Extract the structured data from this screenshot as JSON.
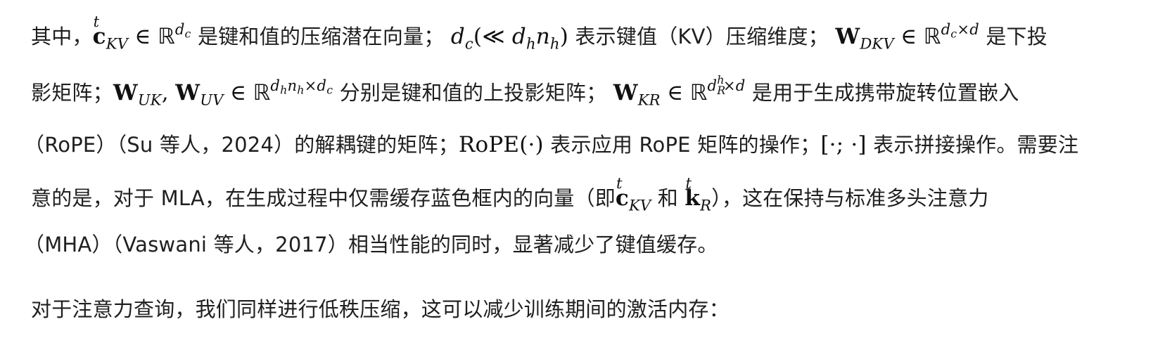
{
  "paragraph1": {
    "l1_a": "其中，",
    "l1_b": "是键和值的压缩潜在向量；",
    "l1_c": "表示键值（KV）压缩维度；",
    "l1_d": "是下投",
    "l2_a": "影矩阵；",
    "l2_b": "分别是键和值的上投影矩阵；",
    "l2_c": "是用于生成携带旋转位置嵌入",
    "l3_a": "（RoPE）（Su 等人，2024）的解耦键的矩阵；",
    "l3_b": "表示应用 RoPE 矩阵的操作；",
    "l3_c": "表示拼接操作。需要注",
    "l4_a": "意的是，对于 MLA，在生成过程中仅需缓存蓝色框内的向量（即",
    "l4_b": "和",
    "l4_c": "），这在保持与标准多头注意力",
    "l5_a": "（MHA）（Vaswani 等人，2017）相当性能的同时，显著减少了键值缓存。"
  },
  "paragraph2": {
    "text": "对于注意力查询，我们同样进行低秩压缩，这可以减少训练期间的激活内存："
  },
  "math": {
    "c": "c",
    "t": "t",
    "kv": "KV",
    "in": "∈",
    "R": "ℝ",
    "d": "d",
    "sub_c": "c",
    "d_c": "d",
    "lparen": "(",
    "ll": "≪",
    "d_h": "d",
    "h": "h",
    "n_h": "n",
    "rparen": ")",
    "W": "W",
    "dkv": "DKV",
    "dc_times_d_1": "d",
    "dc_times_d_2": "c",
    "dc_times_d_3": "×d",
    "uk": "UK",
    "uv": "UV",
    "comma": ",",
    "dhnh_dc_1": "d",
    "dhnh_dc_2": "h",
    "dhnh_dc_3": "n",
    "dhnh_dc_4": "h",
    "dhnh_dc_5": "×d",
    "dhnh_dc_6": "c",
    "kr": "KR",
    "dhR_1": "d",
    "dhR_2": "h",
    "dhR_3": "R",
    "dhR_4": "×d",
    "rope": "RoPE(·)",
    "concat": "[·; ·]",
    "k": "k",
    "R_sub": "R"
  }
}
